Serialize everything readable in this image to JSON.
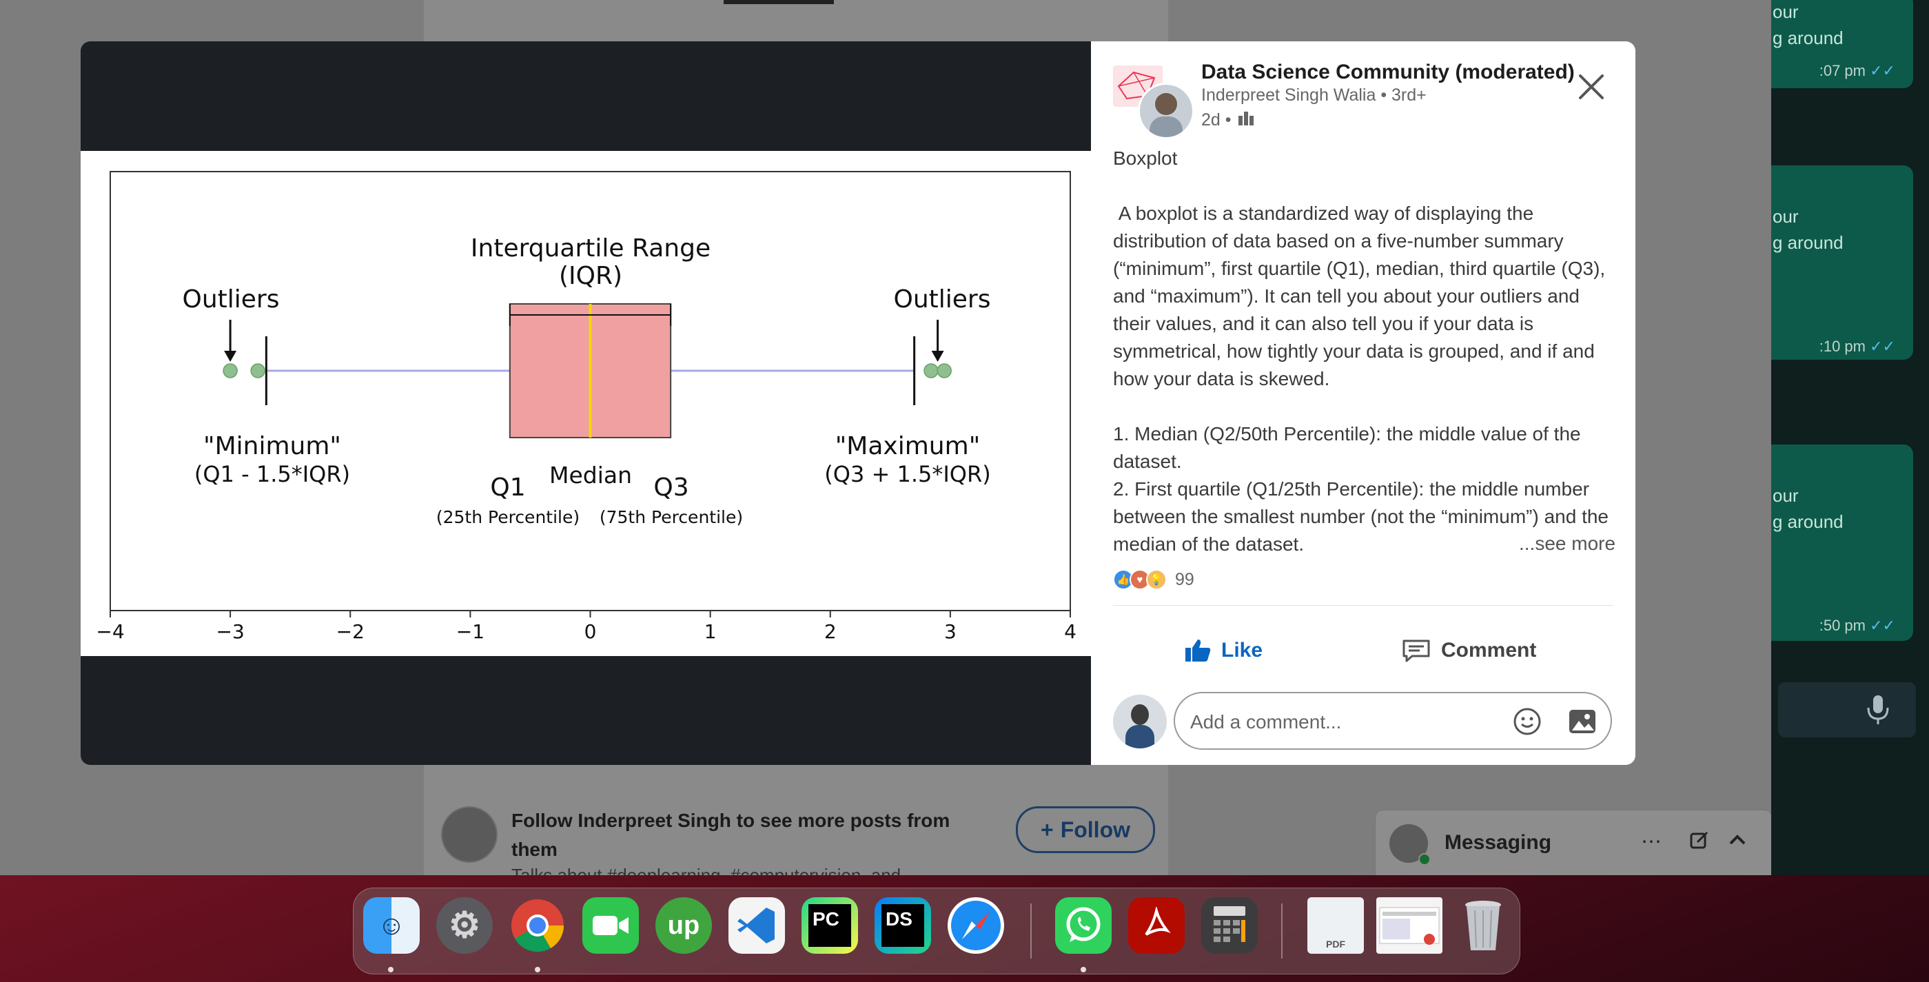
{
  "feed": {
    "follow_text_line1": "Follow Inderpreet Singh to see more posts from",
    "follow_text_line2": "them",
    "follow_button": "Follow",
    "cut_text": "Talks about #deeplearning, #computervision, and"
  },
  "whatsapp": {
    "bubbles": [
      {
        "line1": "our",
        "line2": "g around",
        "time": ":07 pm"
      },
      {
        "line1": "our",
        "line2": "g around",
        "time": ":10 pm"
      },
      {
        "line1": "our",
        "line2": "g around",
        "time": ":50 pm"
      }
    ]
  },
  "messaging": {
    "label": "Messaging"
  },
  "post": {
    "group_name": "Data Science Community (moderated)",
    "author": "Inderpreet Singh Walia • 3rd+",
    "time": "2d •",
    "title": "Boxplot",
    "para1": " A boxplot is a standardized way of displaying the distribution of data based on a five-number summary (“minimum”, first quartile (Q1), median, third quartile (Q3), and “maximum”). It can tell you about your outliers and their values, and it can also tell you if your data is symmetrical, how tightly your data is grouped, and if and how your data is skewed.",
    "item1": "1. Median (Q2/50th Percentile): the middle value of the dataset.",
    "item2": "2. First quartile (Q1/25th Percentile): the middle number between the smallest number (not the “minimum”) and the median of the dataset.",
    "see_more": "...see more",
    "reaction_count": "99",
    "like_label": "Like",
    "comment_label": "Comment",
    "comment_placeholder": "Add a comment..."
  },
  "chart_data": {
    "type": "boxplot",
    "xlim": [
      -4,
      4
    ],
    "x_ticks": [
      "−4",
      "−3",
      "−2",
      "−1",
      "0",
      "1",
      "2",
      "3",
      "4"
    ],
    "whisker_low": -2.7,
    "q1": -0.67,
    "median": 0,
    "q3": 0.67,
    "whisker_high": 2.7,
    "outliers_low": [
      -3.0,
      -2.77
    ],
    "outliers_high": [
      2.84,
      2.95
    ],
    "labels": {
      "iqr_title": "Interquartile Range",
      "iqr_abbr": "(IQR)",
      "outliers_left": "Outliers",
      "outliers_right": "Outliers",
      "minimum": "\"Minimum\"",
      "minimum_formula": "(Q1 - 1.5*IQR)",
      "maximum": "\"Maximum\"",
      "maximum_formula": "(Q3 + 1.5*IQR)",
      "q1": "Q1",
      "median": "Median",
      "q3": "Q3",
      "q1_pct": "(25th Percentile)",
      "q3_pct": "(75th Percentile)"
    },
    "colors": {
      "box": "#f0a0a0",
      "median": "#f5d60a",
      "whisker": "#a9a9e8",
      "outlier": "#8fbf8f"
    }
  },
  "dock": {
    "apps": [
      {
        "name": "finder",
        "label": ""
      },
      {
        "name": "system-preferences",
        "label": ""
      },
      {
        "name": "chrome",
        "label": ""
      },
      {
        "name": "facetime",
        "label": ""
      },
      {
        "name": "upwork",
        "label": "up"
      },
      {
        "name": "vscode",
        "label": ""
      },
      {
        "name": "pycharm",
        "label": "PC"
      },
      {
        "name": "dataspell",
        "label": "DS"
      },
      {
        "name": "safari",
        "label": ""
      },
      {
        "name": "whatsapp",
        "label": ""
      },
      {
        "name": "acrobat",
        "label": ""
      },
      {
        "name": "calculator",
        "label": ""
      },
      {
        "name": "pdf-document",
        "label": "PDF"
      },
      {
        "name": "screenshot-stack",
        "label": ""
      },
      {
        "name": "trash",
        "label": ""
      }
    ]
  }
}
